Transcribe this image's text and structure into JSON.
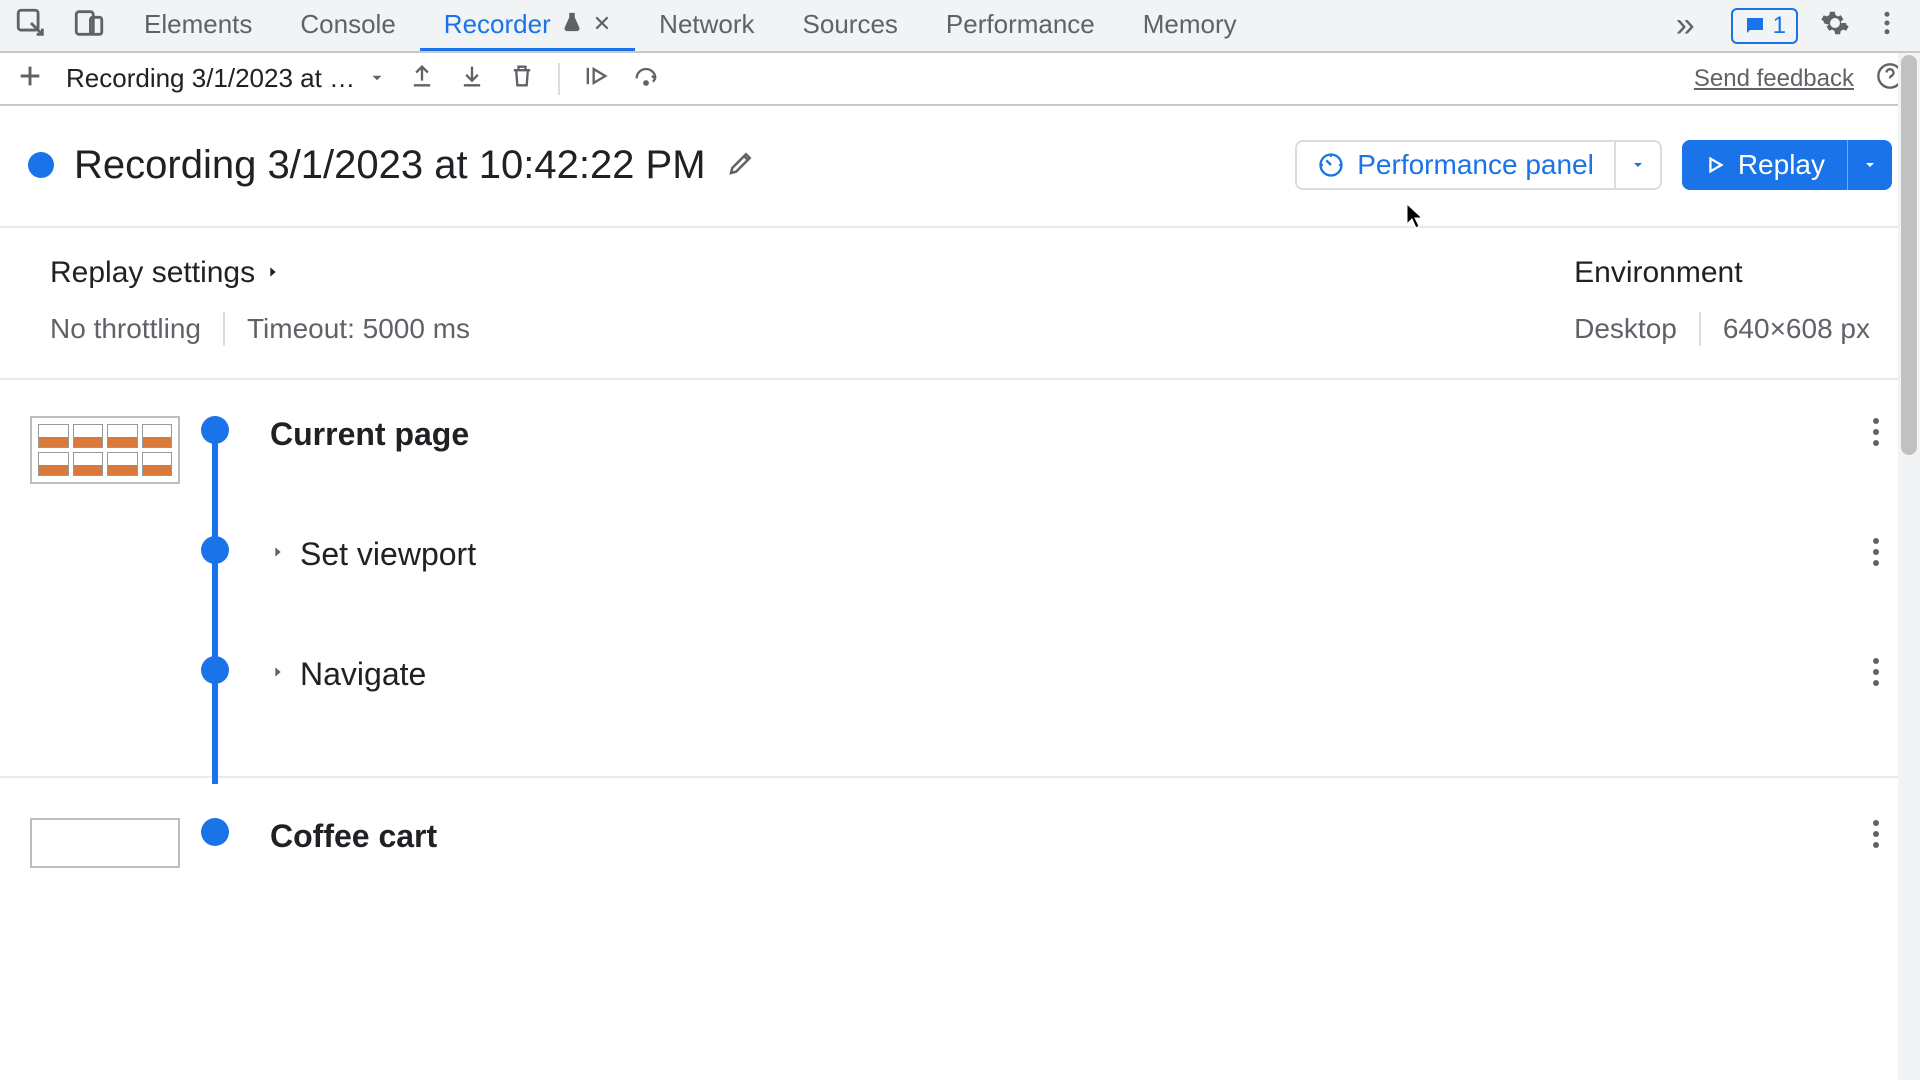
{
  "tabs": {
    "elements": "Elements",
    "console": "Console",
    "recorder": "Recorder",
    "network": "Network",
    "sources": "Sources",
    "performance": "Performance",
    "memory": "Memory"
  },
  "issue_count": "1",
  "toolbar": {
    "recording_select": "Recording 3/1/2023 at 10…",
    "feedback": "Send feedback"
  },
  "header": {
    "title": "Recording 3/1/2023 at 10:42:22 PM",
    "perf_label": "Performance panel",
    "replay_label": "Replay"
  },
  "settings": {
    "heading": "Replay settings",
    "throttling": "No throttling",
    "timeout": "Timeout: 5000 ms",
    "env_heading": "Environment",
    "env_device": "Desktop",
    "env_size": "640×608 px"
  },
  "steps": {
    "s0": "Current page",
    "s1": "Set viewport",
    "s2": "Navigate",
    "s3": "Coffee cart"
  }
}
